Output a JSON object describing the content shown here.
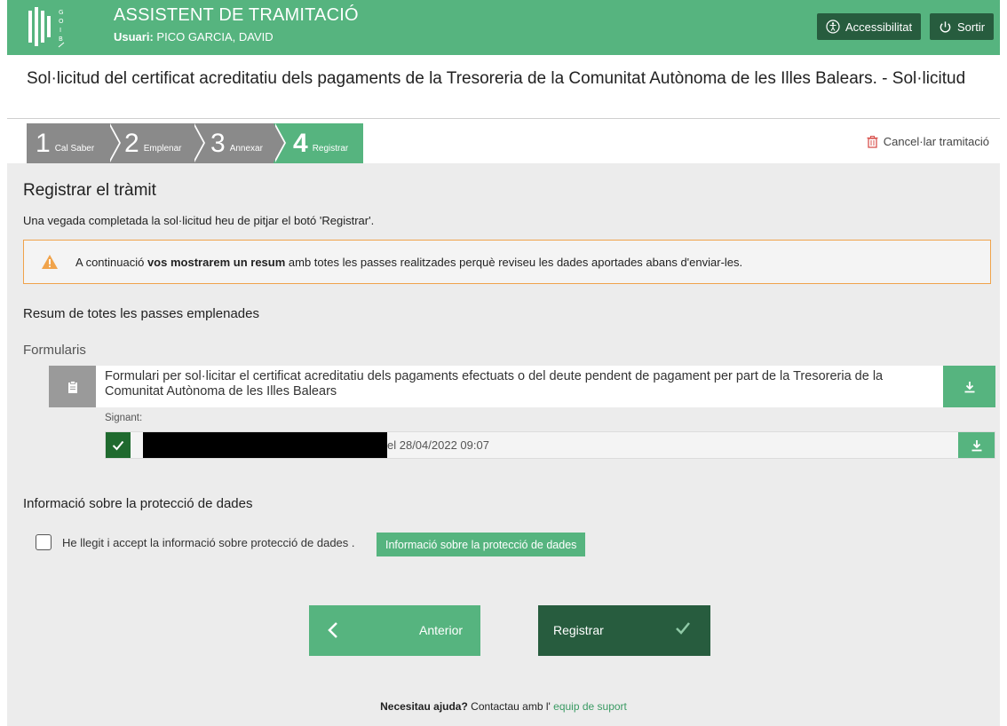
{
  "header": {
    "app_title": "ASSISTENT DE TRAMITACIÓ",
    "user_label": "Usuari:",
    "user_name": "PICO GARCIA, DAVID",
    "logo_text": "GOIB",
    "accessibility_label": "Accessibilitat",
    "exit_label": "Sortir",
    "brand_color": "#56b47f",
    "dark_color": "#275c3e"
  },
  "procedure_title": "Sol·licitud del certificat acreditatiu dels pagaments de la Tresoreria de la Comunitat Autònoma de les Illes Balears. - Sol·licitud",
  "steps": [
    {
      "num": "1",
      "label": "Cal Saber",
      "state": "done"
    },
    {
      "num": "2",
      "label": "Emplenar",
      "state": "done"
    },
    {
      "num": "3",
      "label": "Annexar",
      "state": "done"
    },
    {
      "num": "4",
      "label": "Registrar",
      "state": "active"
    }
  ],
  "cancel_label": "Cancel·lar tramitació",
  "main": {
    "section_title": "Registrar el tràmit",
    "intro": "Una vegada completada la sol·licitud heu de pitjar el botó 'Registrar'.",
    "warning_pre": "A continuació ",
    "warning_bold": "vos mostrarem un resum",
    "warning_post": " amb totes les passes realitzades perquè reviseu les dades aportades abans d'enviar-les.",
    "summary_title": "Resum de totes les passes emplenades",
    "forms_label": "Formularis",
    "form_text": "Formulari per sol·licitar el certificat acreditatiu dels pagaments efectuats o del deute pendent de pagament per part de la Tresoreria de la Comunitat Autònoma de les Illes Balears",
    "signant_label": "Signant:",
    "signature_text": "el 28/04/2022 09:07",
    "privacy_title": "Informació sobre la protecció de dades",
    "privacy_checkbox_label": "He llegit i accept la informació sobre protecció de dades .",
    "privacy_button": "Informació sobre la protecció de dades",
    "privacy_checked": false
  },
  "nav": {
    "prev_label": "Anterior",
    "next_label": "Registrar"
  },
  "footer": {
    "help_bold": "Necesitau ajuda?",
    "help_text": " Contactau amb l' ",
    "help_link": "equip de suport"
  }
}
